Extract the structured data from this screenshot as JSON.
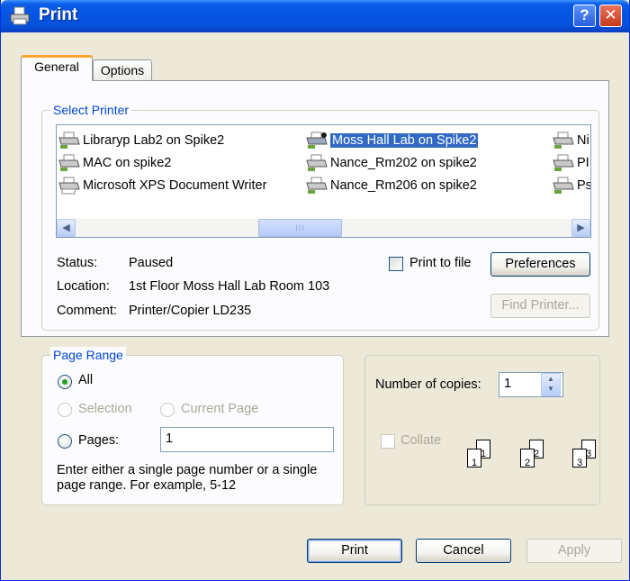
{
  "window": {
    "title": "Print",
    "help_label": "?",
    "close_label": "✕"
  },
  "tabs": [
    {
      "label": "General",
      "selected": true
    },
    {
      "label": "Options",
      "selected": false
    }
  ],
  "select_printer": {
    "group_label": "Select Printer",
    "printers": [
      {
        "name": "Libraryp Lab2 on Spike2",
        "selected": false
      },
      {
        "name": "MAC on spike2",
        "selected": false
      },
      {
        "name": "Microsoft XPS Document Writer",
        "selected": false
      },
      {
        "name": "Moss Hall Lab on Spike2",
        "selected": true
      },
      {
        "name": "Nance_Rm202 on spike2",
        "selected": false
      },
      {
        "name": "Nance_Rm206 on spike2",
        "selected": false
      },
      {
        "name": "Ni",
        "selected": false
      },
      {
        "name": "PI",
        "selected": false
      },
      {
        "name": "Ps",
        "selected": false
      }
    ],
    "scroll_thumb_grip": "III",
    "status_label": "Status:",
    "status_value": "Paused",
    "location_label": "Location:",
    "location_value": "1st Floor Moss Hall Lab Room 103",
    "comment_label": "Comment:",
    "comment_value": "Printer/Copier LD235",
    "print_to_file_label": "Print to file",
    "preferences_label": "Preferences",
    "find_printer_label": "Find Printer..."
  },
  "page_range": {
    "group_label": "Page Range",
    "all_label": "All",
    "selection_label": "Selection",
    "current_page_label": "Current Page",
    "pages_label": "Pages:",
    "pages_value": "1",
    "hint_line1": "Enter either a single page number or a single",
    "hint_line2": "page range.  For example, 5-12"
  },
  "copies": {
    "label": "Number of copies:",
    "value": "1",
    "collate_label": "Collate",
    "collate_pages": [
      "1",
      "1",
      "2",
      "2",
      "3",
      "3"
    ]
  },
  "buttons": {
    "print": "Print",
    "cancel": "Cancel",
    "apply": "Apply"
  },
  "colors": {
    "titlebar": "#0554e3",
    "group_label": "#0046d5",
    "selection": "#316ac5",
    "dialog_face": "#ece9d8"
  }
}
